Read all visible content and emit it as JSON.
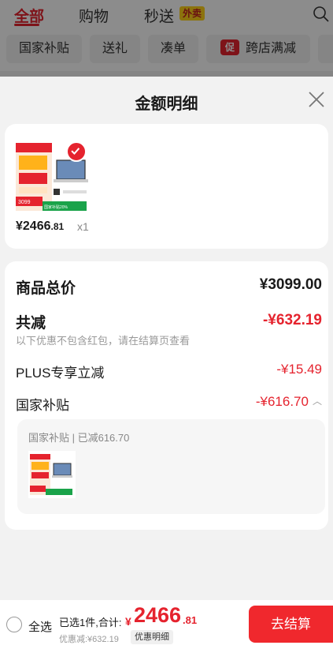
{
  "top_tabs": [
    {
      "label": "全部"
    },
    {
      "label": "购物"
    },
    {
      "label": "秒送"
    }
  ],
  "takeout_badge": "外卖",
  "chips": [
    {
      "label": "国家补贴"
    },
    {
      "label": "送礼"
    },
    {
      "label": "凑单"
    },
    {
      "label": "跨店满减"
    }
  ],
  "promo_icon_text": "促",
  "sheet": {
    "title": "金额明细"
  },
  "item": {
    "price_main": "¥2466",
    "price_decimal": ".81",
    "quantity": "x1",
    "thumbnail_texts": {
      "price_tag": "3099",
      "subsidy_tag": "国家补贴20%"
    }
  },
  "summary": {
    "total_label": "商品总价",
    "total_value": "¥3099.00",
    "discount_label": "共减",
    "discount_value": "-¥632.19",
    "discount_note": "以下优惠不包含红包，请在结算页查看",
    "plus_label": "PLUS专享立减",
    "plus_value": "-¥15.49",
    "subsidy_label": "国家补贴",
    "subsidy_value": "-¥616.70",
    "subsidy_detail": "国家补贴 | 已减616.70"
  },
  "bottom": {
    "select_all": "全选",
    "selected_info": "已选1件,合计:",
    "currency": "¥",
    "total_int": "2466",
    "total_dec": ".81",
    "discount_note": "优惠减:¥632.19",
    "detail_button": "优惠明细",
    "checkout_button": "去结算"
  },
  "colors": {
    "accent": "#e5232e",
    "subsidy_green": "#1aa34a"
  }
}
